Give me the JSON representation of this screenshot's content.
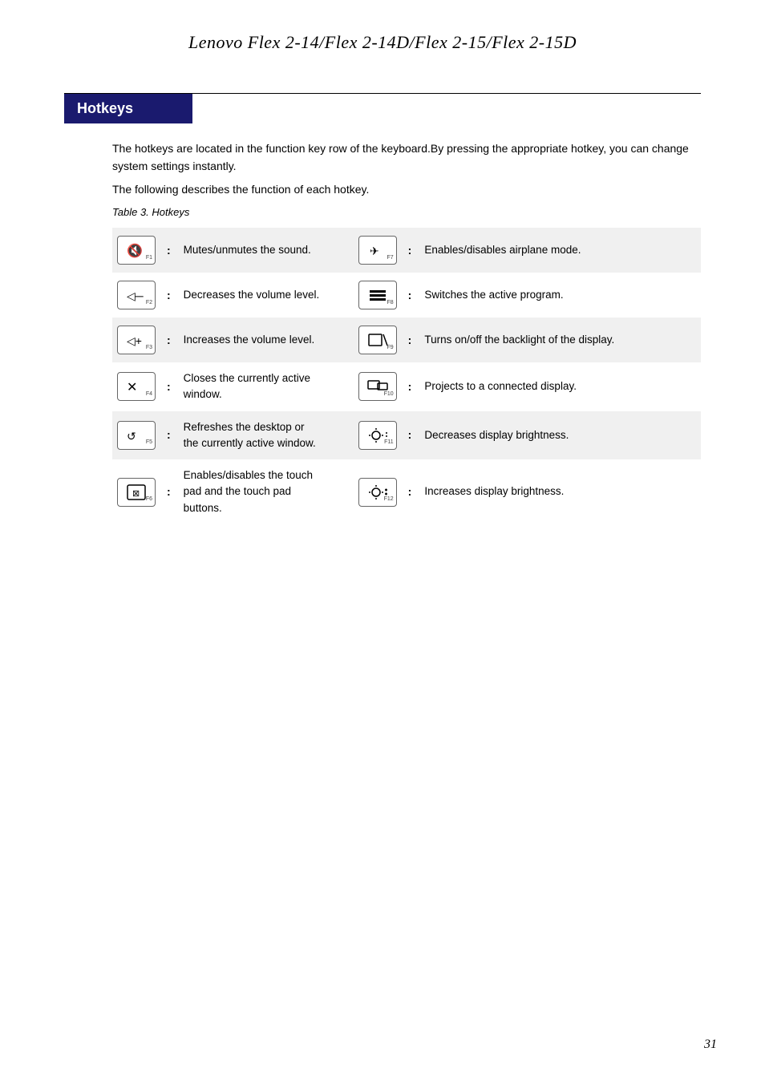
{
  "page": {
    "title": "Lenovo Flex 2-14/Flex 2-14D/Flex 2-15/Flex 2-15D",
    "page_number": "31"
  },
  "section": {
    "heading": "Hotkeys",
    "intro_line1": "The hotkeys are located in the function key row of the keyboard.By pressing the appropriate hotkey, you can change system settings instantly.",
    "intro_line2": "The following describes the function of each hotkey.",
    "table_caption": "Table 3. Hotkeys"
  },
  "hotkeys": {
    "left_column": [
      {
        "key_icon": "🔇",
        "key_fn": "F1",
        "description": "Mutes/unmutes the sound."
      },
      {
        "key_icon": "🔉",
        "key_fn": "F2",
        "description": "Decreases the volume level."
      },
      {
        "key_icon": "🔊",
        "key_fn": "F3",
        "description": "Increases the volume level."
      },
      {
        "key_icon": "✕",
        "key_fn": "F4",
        "description": "Closes the currently active window."
      },
      {
        "key_icon": "↺",
        "key_fn": "F5",
        "description": "Refreshes the desktop or the currently active window."
      },
      {
        "key_icon": "⬜",
        "key_fn": "F6",
        "description": "Enables/disables the touch pad and the touch pad buttons."
      }
    ],
    "right_column": [
      {
        "key_icon": "✈",
        "key_fn": "F7",
        "description": "Enables/disables airplane mode."
      },
      {
        "key_icon": "▬▬▬",
        "key_fn": "F8",
        "description": "Switches the active program."
      },
      {
        "key_icon": "⬜✕",
        "key_fn": "F9",
        "description": "Turns on/off the backlight of the display."
      },
      {
        "key_icon": "⬜⬜",
        "key_fn": "F10",
        "description": "Projects to a connected display."
      },
      {
        "key_icon": "☼",
        "key_fn": "F11",
        "description": "Decreases display brightness."
      },
      {
        "key_icon": "☀",
        "key_fn": "F12",
        "description": "Increases display brightness."
      }
    ]
  }
}
